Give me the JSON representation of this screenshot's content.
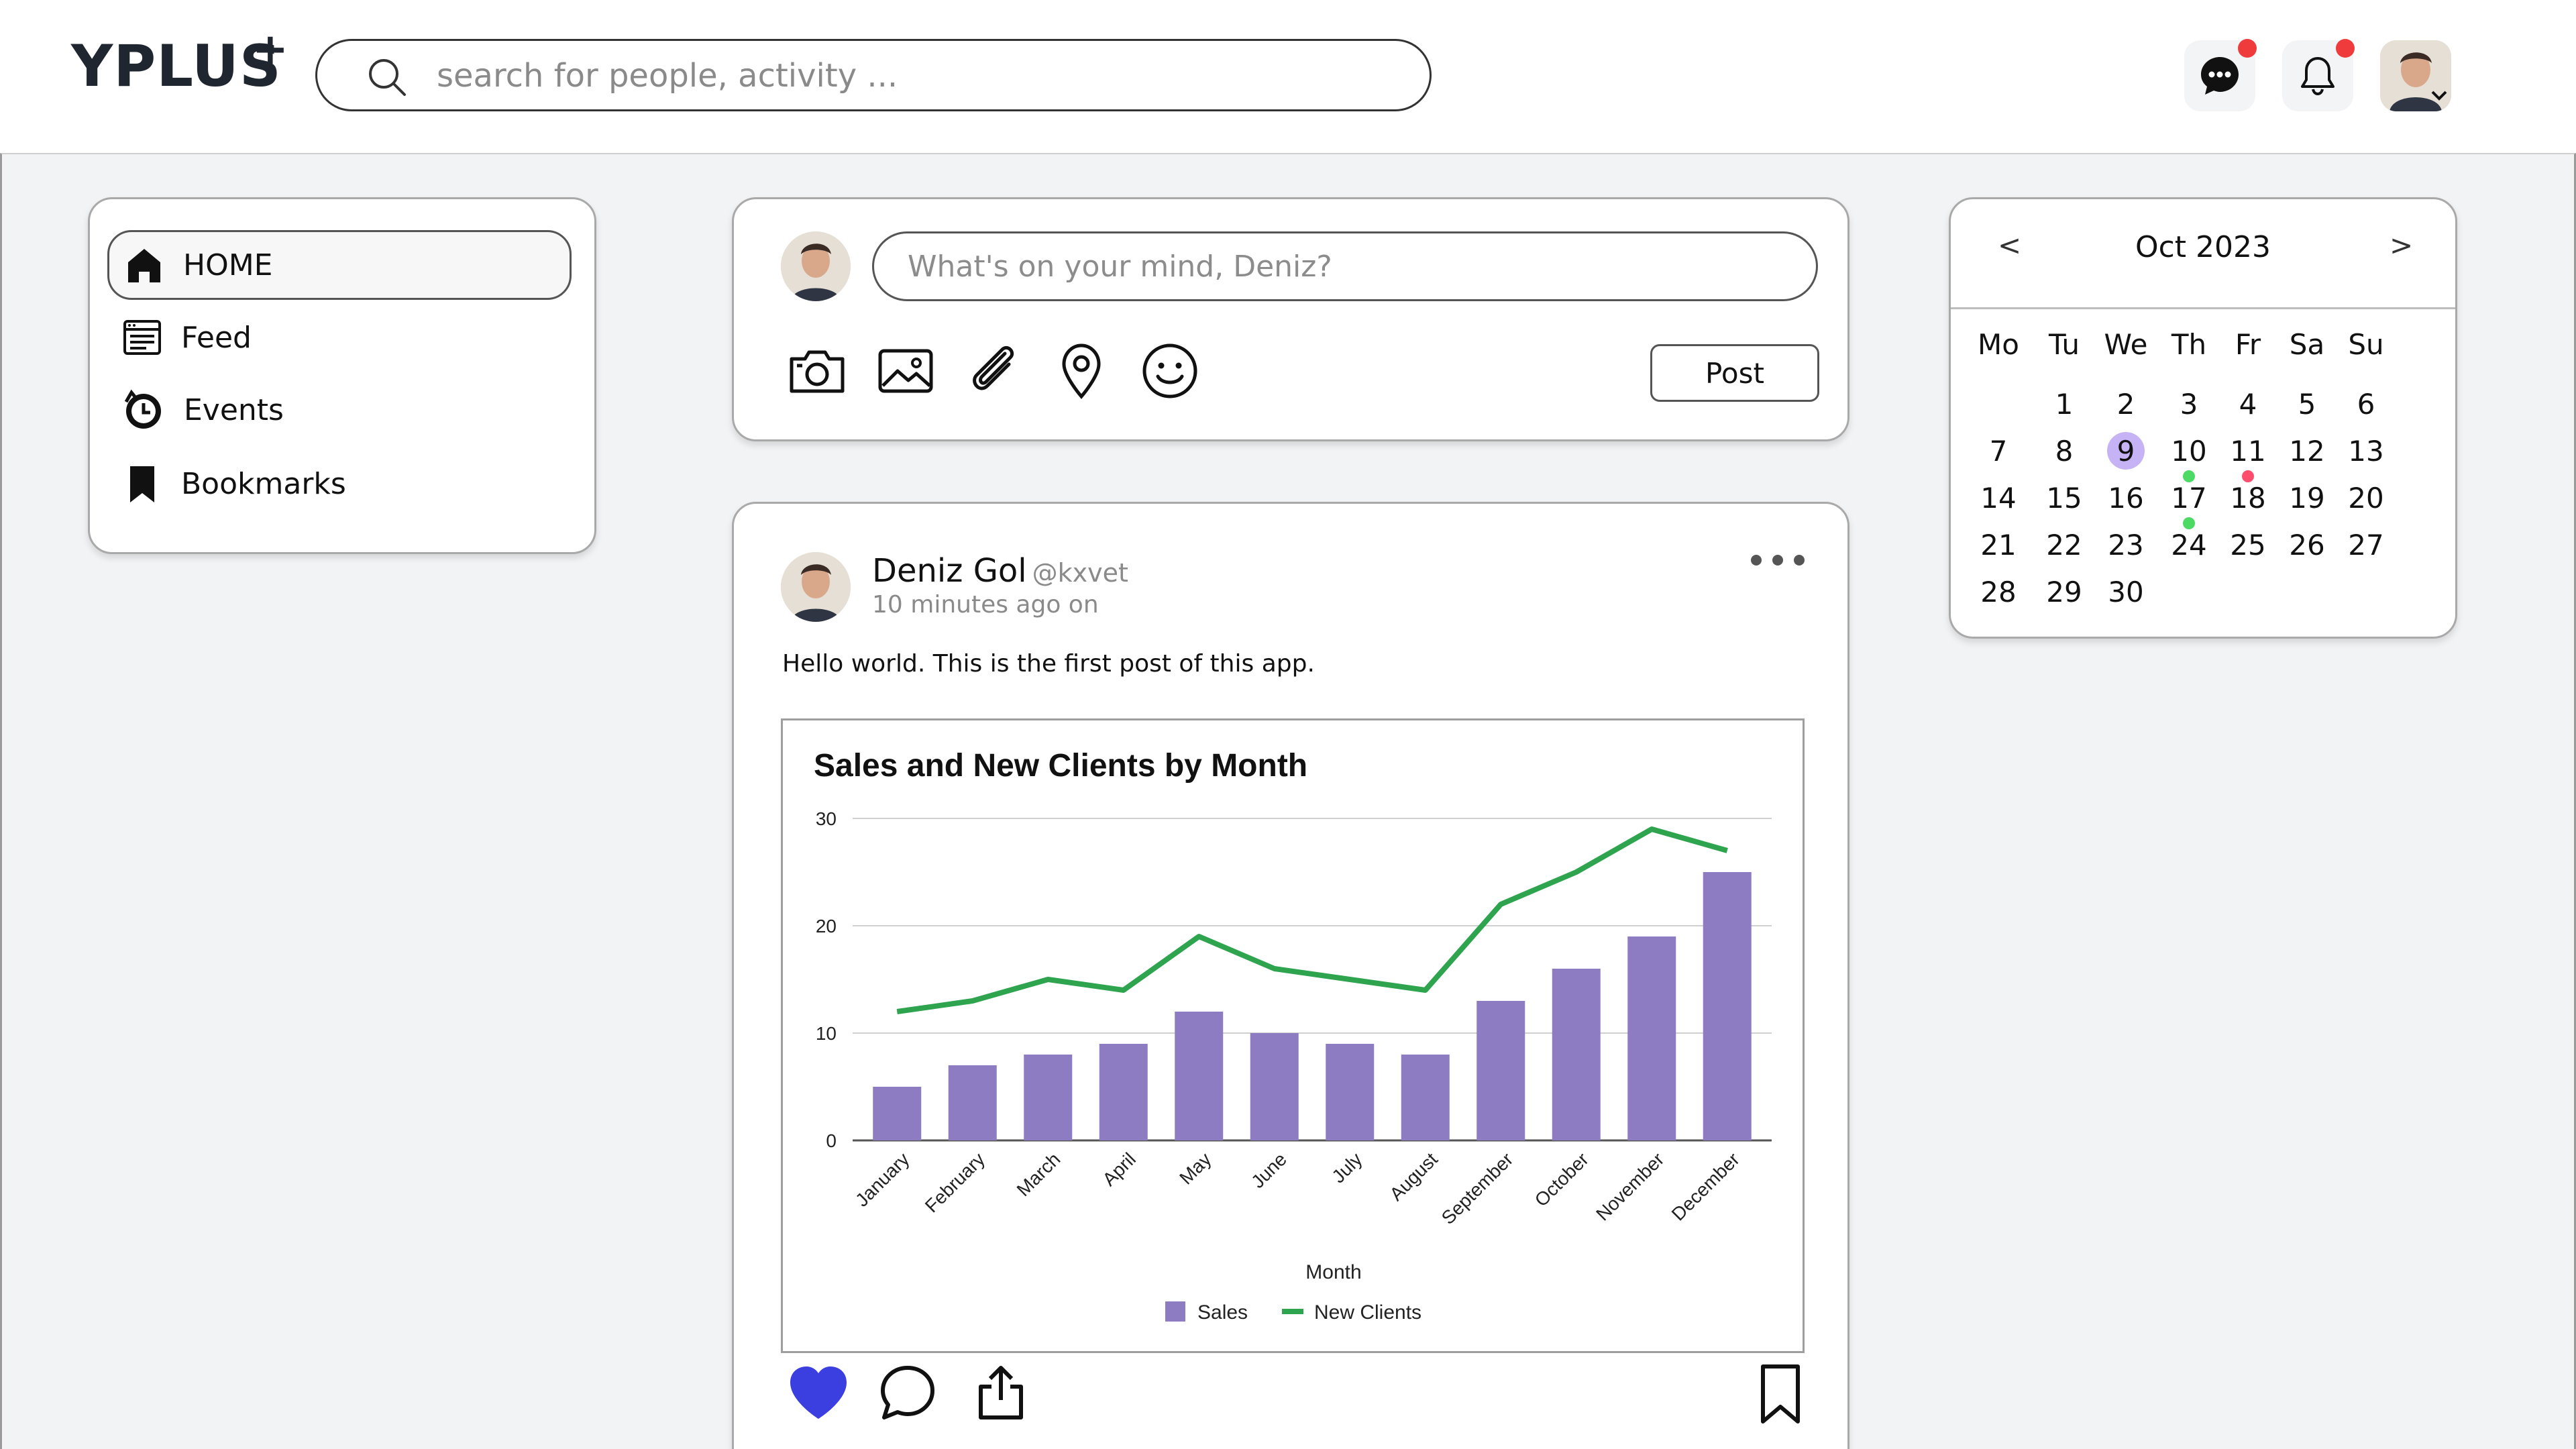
{
  "app": {
    "logo": "YPLUS",
    "logo_plus": "+"
  },
  "search": {
    "placeholder": "search for people, activity ..."
  },
  "header": {
    "icons": [
      "messages-icon",
      "bell-icon"
    ],
    "badge_color": "#ef3b3b"
  },
  "nav": {
    "items": [
      {
        "label": "HOME",
        "icon": "home-icon",
        "active": true
      },
      {
        "label": "Feed",
        "icon": "feed-icon",
        "active": false
      },
      {
        "label": "Events",
        "icon": "events-icon",
        "active": false
      },
      {
        "label": "Bookmarks",
        "icon": "bookmark-icon",
        "active": false
      }
    ]
  },
  "composer": {
    "placeholder": "What's on your mind, Deniz?",
    "post_label": "Post",
    "tools": [
      "camera-icon",
      "image-icon",
      "paperclip-icon",
      "location-pin-icon",
      "smiley-icon"
    ]
  },
  "post": {
    "author": "Deniz Gol",
    "handle": "@kxvet",
    "time": "10 minutes ago on",
    "text": "Hello world. This is the first post of this app.",
    "actions": [
      "heart-icon",
      "comment-icon",
      "share-icon",
      "bookmark-icon"
    ],
    "like_color": "#3b3fe0"
  },
  "chart_data": {
    "type": "bar",
    "title": "Sales and New Clients by Month",
    "xlabel": "Month",
    "ylabel": "",
    "ylim": [
      0,
      30
    ],
    "yticks": [
      0,
      10,
      20,
      30
    ],
    "categories": [
      "January",
      "February",
      "March",
      "April",
      "May",
      "June",
      "July",
      "August",
      "September",
      "October",
      "November",
      "December"
    ],
    "series": [
      {
        "name": "Sales",
        "type": "bar",
        "color": "#8e7cc3",
        "values": [
          5,
          7,
          8,
          9,
          12,
          10,
          9,
          8,
          13,
          16,
          19,
          25
        ]
      },
      {
        "name": "New Clients",
        "type": "line",
        "color": "#2ea44f",
        "values": [
          12,
          13,
          15,
          14,
          19,
          16,
          15,
          14,
          22,
          25,
          29,
          27
        ]
      }
    ],
    "grid": true,
    "legend": "bottom"
  },
  "calendar": {
    "title": "Oct 2023",
    "prev": "<",
    "next": ">",
    "weekdays": [
      "Mo",
      "Tu",
      "We",
      "Th",
      "Fr",
      "Sa",
      "Su"
    ],
    "first_weekday_index": 1,
    "days_in_month": 30,
    "selected": 9,
    "selected_color": "#c5b3f5",
    "markers": [
      {
        "day": 10,
        "color": "#4cd964"
      },
      {
        "day": 11,
        "color": "#ff4d6d"
      },
      {
        "day": 17,
        "color": "#4cd964"
      }
    ]
  }
}
